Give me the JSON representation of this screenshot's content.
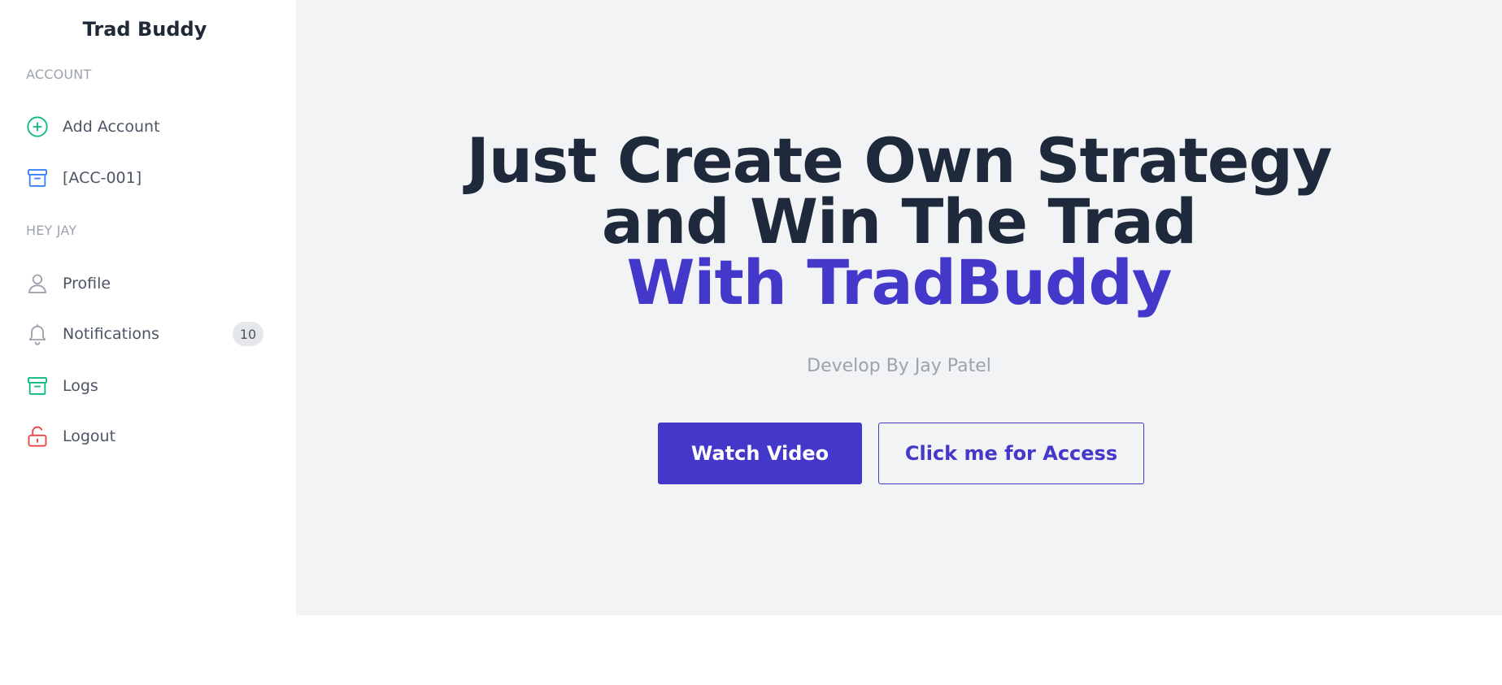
{
  "sidebar": {
    "brand": "Trad Buddy",
    "sections": [
      {
        "label": "ACCOUNT",
        "items": [
          {
            "label": "Add Account",
            "icon": "plus-circle-icon",
            "color": "#10b981"
          },
          {
            "label": "[ACC-001]",
            "icon": "archive-icon",
            "color": "#3b82f6"
          }
        ]
      },
      {
        "label": "HEY JAY",
        "items": [
          {
            "label": "Profile",
            "icon": "user-icon",
            "color": "#9ca3af"
          },
          {
            "label": "Notifications",
            "icon": "bell-icon",
            "color": "#9ca3af",
            "badge": "10"
          },
          {
            "label": "Logs",
            "icon": "archive-icon",
            "color": "#10b981"
          },
          {
            "label": "Logout",
            "icon": "unlock-icon",
            "color": "#ef4444"
          }
        ]
      }
    ]
  },
  "hero": {
    "line1": "Just Create Own Strategy",
    "line2": "and Win The Trad",
    "line3": "With TradBuddy",
    "subtitle": "Develop By Jay Patel",
    "primary_button": "Watch Video",
    "secondary_button": "Click me for Access"
  },
  "colors": {
    "accent": "#4338ca",
    "heading": "#1e293b",
    "muted": "#9ca3af",
    "main_bg": "#f2f3f5"
  }
}
